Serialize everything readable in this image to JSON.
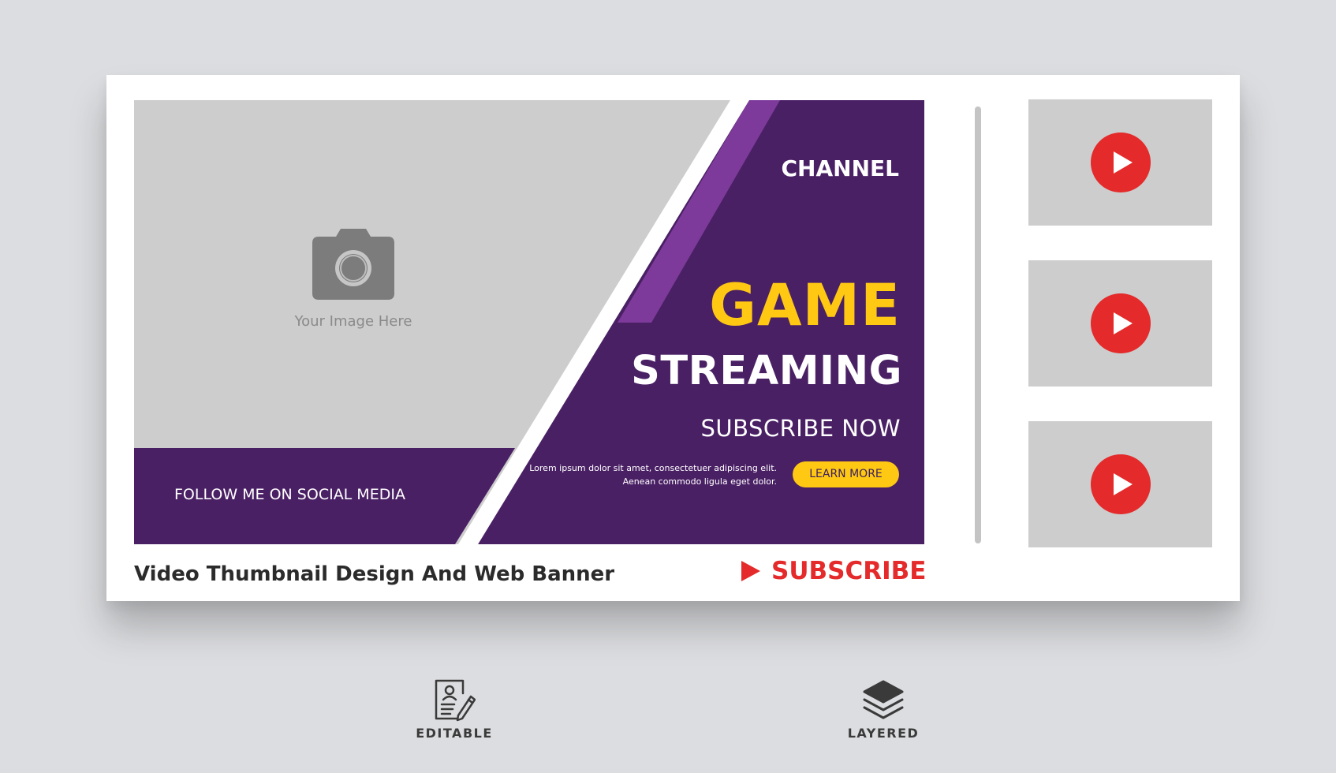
{
  "banner": {
    "image_placeholder": "Your Image Here",
    "follow_text": "FOLLOW ME ON SOCIAL MEDIA",
    "channel": "CHANNEL",
    "headline_1": "GAME",
    "headline_2": "STREAMING",
    "subscribe_now": "SUBSCRIBE NOW",
    "lorem_line_1": "Lorem ipsum dolor sit amet, consectetuer adipiscing elit.",
    "lorem_line_2": "Aenean commodo ligula eget dolor.",
    "learn_more": "LEARN MORE"
  },
  "footer": {
    "caption": "Video Thumbnail Design And Web Banner",
    "subscribe": "SUBSCRIBE"
  },
  "thumbnails": [
    {
      "icon": "play-icon"
    },
    {
      "icon": "play-icon"
    },
    {
      "icon": "play-icon"
    }
  ],
  "features": [
    {
      "icon": "editable-icon",
      "label": "EDITABLE"
    },
    {
      "icon": "layers-icon",
      "label": "LAYERED"
    }
  ],
  "colors": {
    "background": "#dcdde0",
    "purple": "#4a2065",
    "purple_light": "#7d3a9a",
    "yellow": "#ffc812",
    "placeholder_gray": "#cdcdcd",
    "red": "#e42a2a"
  }
}
